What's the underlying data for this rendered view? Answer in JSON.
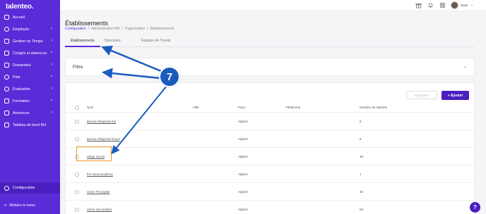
{
  "app": {
    "logo": "talenteo."
  },
  "sidebar": {
    "items": [
      {
        "label": "Accueil",
        "icon": "home-icon",
        "chevron": ""
      },
      {
        "label": "Employés",
        "icon": "users-icon",
        "chevron": "›"
      },
      {
        "label": "Gestion du Temps",
        "icon": "clock-icon",
        "chevron": "›"
      },
      {
        "label": "Congés et absences",
        "icon": "calendar-icon",
        "chevron": "›"
      },
      {
        "label": "Demandes",
        "icon": "inbox-icon",
        "chevron": "›"
      },
      {
        "label": "Paie",
        "icon": "money-icon",
        "chevron": "›"
      },
      {
        "label": "Évaluation",
        "icon": "evaluation-icon",
        "chevron": "›"
      },
      {
        "label": "Formation",
        "icon": "education-icon",
        "chevron": "›"
      },
      {
        "label": "Annonces",
        "icon": "megaphone-icon",
        "chevron": "›"
      },
      {
        "label": "Tableau de bord RH",
        "icon": "dashboard-icon",
        "chevron": ""
      }
    ],
    "config_label": "Configuration",
    "collapse_label": "Réduire le menu",
    "collapse_arrow": "«"
  },
  "topbar": {
    "icons": [
      "gift-icon",
      "bell-icon",
      "apps-grid-icon"
    ],
    "user_name": "Sami",
    "user_chevron": "⌄"
  },
  "header": {
    "title": "Établissements",
    "breadcrumb": [
      "Configuration",
      "Administration RH",
      "Organisation",
      "Établissements"
    ],
    "breadcrumb_sep": "/"
  },
  "tabs": [
    "Établissements",
    "Structures",
    "Équipes de Travail"
  ],
  "filter": {
    "label": "Filtre",
    "chevron": "⌄"
  },
  "table": {
    "delete_label": "Supprimer",
    "add_label": "+ Ajouter",
    "columns": [
      "Nom",
      "Ville",
      "Pays",
      "Téléphone",
      "Nombre de salariés"
    ],
    "rows": [
      {
        "name": "Bureau Régional Est",
        "city": "",
        "country": "Algérie",
        "phone": "",
        "count": "6"
      },
      {
        "name": "Bureau Régional Ouest",
        "city": "",
        "country": "Algérie",
        "phone": "",
        "count": "6"
      },
      {
        "name": "Siège Social",
        "city": "",
        "country": "Algérie",
        "phone": "",
        "count": "48"
      },
      {
        "name": "the seed academy",
        "city": "",
        "country": "Algérie",
        "phone": "",
        "count": "1"
      },
      {
        "name": "Usine Principale",
        "city": "",
        "country": "Algérie",
        "phone": "",
        "count": "35"
      },
      {
        "name": "Usine Secondaire",
        "city": "",
        "country": "Algérie",
        "phone": "",
        "count": "53"
      }
    ]
  },
  "annotation": {
    "step": "7"
  },
  "help": {
    "label": "?"
  },
  "colors": {
    "brand": "#5b2bd8",
    "brand_dark": "#4a1fbf",
    "annotation": "#1a5bbf",
    "highlight": "#f0962a"
  }
}
